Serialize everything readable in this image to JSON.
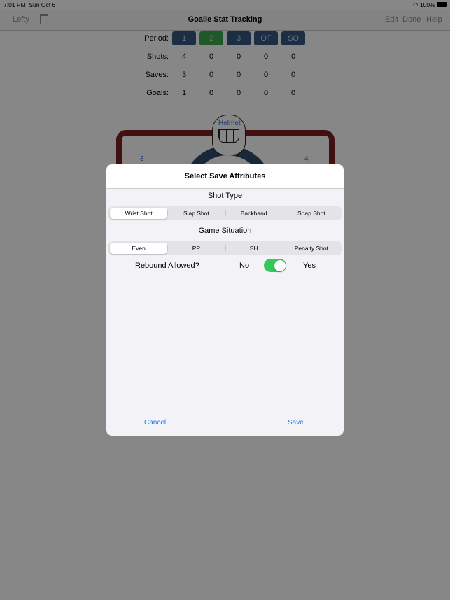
{
  "status": {
    "time": "7:01 PM",
    "date": "Sun Oct 6",
    "battery": "100%"
  },
  "nav": {
    "title": "Goalie Stat Tracking",
    "left": "Lefty",
    "edit": "Edit",
    "done": "Done",
    "help": "Help"
  },
  "stats": {
    "period_label": "Period:",
    "periods": [
      "1",
      "2",
      "3",
      "OT",
      "SO"
    ],
    "selected_period": "2",
    "rows": [
      {
        "label": "Shots:",
        "values": [
          "4",
          "0",
          "0",
          "0",
          "0"
        ]
      },
      {
        "label": "Saves:",
        "values": [
          "3",
          "0",
          "0",
          "0",
          "0"
        ]
      },
      {
        "label": "Goals:",
        "values": [
          "1",
          "0",
          "0",
          "0",
          "0"
        ]
      }
    ]
  },
  "net": {
    "helmet_label": "Helmet",
    "zone_left": "3",
    "zone_right": "4"
  },
  "modal": {
    "title": "Select Save Attributes",
    "shot_type_label": "Shot Type",
    "shot_types": [
      "Wrist Shot",
      "Slap Shot",
      "Backhand",
      "Snap Shot"
    ],
    "selected_shot_type": "Wrist Shot",
    "situation_label": "Game Situation",
    "situations": [
      "Even",
      "PP",
      "SH",
      "Penalty Shot"
    ],
    "selected_situation": "Even",
    "rebound_label": "Rebound Allowed?",
    "no": "No",
    "yes": "Yes",
    "rebound_allowed": true,
    "cancel": "Cancel",
    "save": "Save"
  },
  "colors": {
    "accent": "#1a7cf5",
    "toggle_on": "#34c759",
    "period_selected": "#3ea84f",
    "period": "#34587f"
  }
}
